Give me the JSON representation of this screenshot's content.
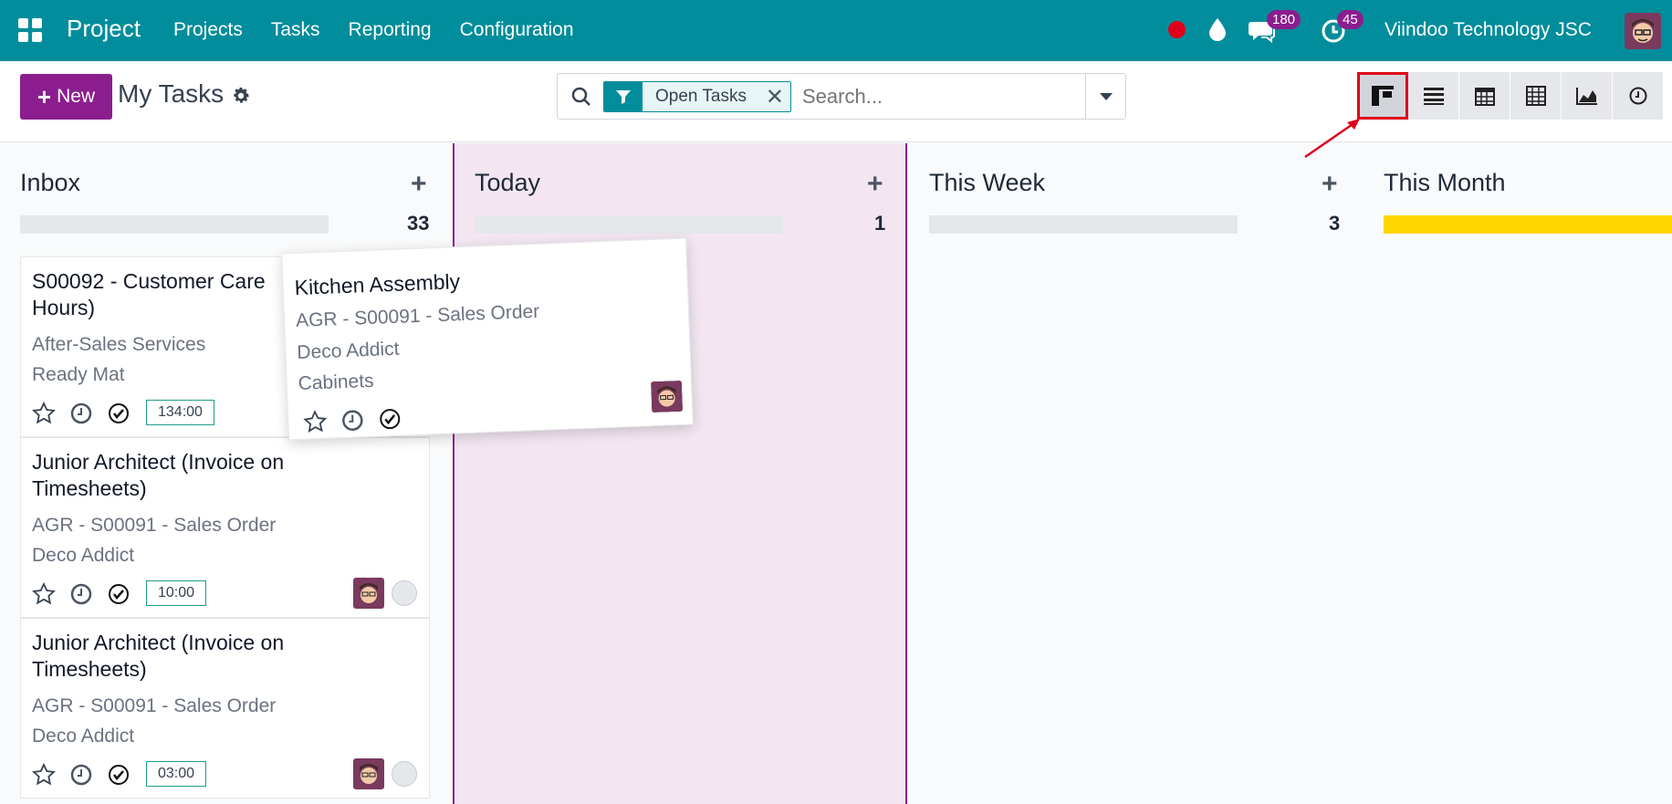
{
  "navbar": {
    "brand": "Project",
    "menu": [
      "Projects",
      "Tasks",
      "Reporting",
      "Configuration"
    ],
    "chat_count": "180",
    "activity_count": "45",
    "company": "Viindoo Technology JSC"
  },
  "control": {
    "new_label": "New",
    "title": "My Tasks",
    "facet_label": "Open Tasks",
    "search_placeholder": "Search...",
    "views": [
      "kanban",
      "list",
      "calendar",
      "pivot",
      "graph",
      "activity"
    ]
  },
  "columns": [
    {
      "name": "Inbox",
      "count": "33"
    },
    {
      "name": "Today",
      "count": "1"
    },
    {
      "name": "This Week",
      "count": "3"
    },
    {
      "name": "This Month",
      "count": ""
    }
  ],
  "cards": [
    {
      "title_1": "S00092 - Customer Care",
      "title_2": "Hours)",
      "line_1": "After-Sales Services",
      "line_2": "Ready Mat",
      "hours": "134:00"
    },
    {
      "title_1": "Junior Architect (Invoice on",
      "title_2": "Timesheets)",
      "line_1": "AGR - S00091 - Sales Order",
      "line_2": "Deco Addict",
      "hours": "10:00"
    },
    {
      "title_1": "Junior Architect (Invoice on",
      "title_2": "Timesheets)",
      "line_1": "AGR - S00091 - Sales Order",
      "line_2": "Deco Addict",
      "hours": "03:00"
    }
  ],
  "drag_card": {
    "title": "Kitchen Assembly",
    "line_1": "AGR - S00091 - Sales Order",
    "line_2": "Deco Addict",
    "line_3": "Cabinets"
  },
  "colors": {
    "navbar": "#018d9b",
    "primary": "#8b1d8f",
    "highlight": "#e0001a",
    "month_bar": "#ffd600"
  }
}
